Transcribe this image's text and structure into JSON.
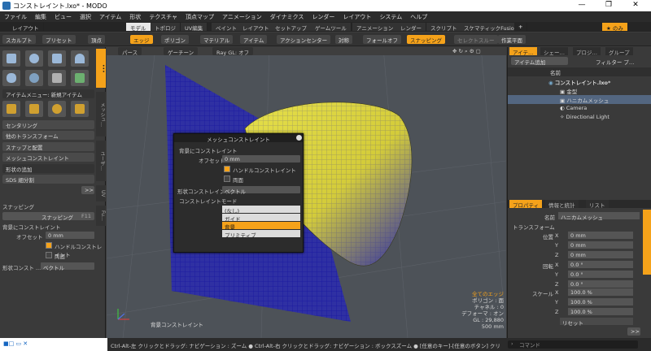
{
  "window": {
    "title": "コンストレイント.lxo* - MODO",
    "minimize": "—",
    "maximize": "❐",
    "close": "✕"
  },
  "menu": [
    "ファイル",
    "編集",
    "ビュー",
    "選択",
    "アイテム",
    "形状",
    "テクスチャ",
    "頂点マップ",
    "アニメーション",
    "ダイナミクス",
    "レンダー",
    "レイアウト",
    "システム",
    "ヘルプ"
  ],
  "layoutbar": {
    "layout_label": "レイアウト",
    "tabs": [
      "モデル",
      "トポロジ",
      "UV編集",
      "ペイント",
      "レイアウト",
      "セットアップ",
      "ゲームツール",
      "アニメーション",
      "レンダー",
      "スクリプト",
      "スケマティックFusion"
    ],
    "add": "+",
    "star": "★ のみ"
  },
  "toolbar": {
    "items": [
      "スカルプト",
      "プリセット",
      "頂点",
      "エッジ",
      "ポリゴン",
      "マテリアル",
      "アイテム",
      "アクションセンター",
      "対称",
      "フォールオフ",
      "スナッピング",
      "セレクトスルー",
      "作業平面"
    ]
  },
  "left": {
    "item_menu": "アイテムメニュー: 新規アイテム",
    "centering": "センタリング",
    "other_transform": "他のトランスフォーム",
    "snap_place": "スナップと配置",
    "mesh_constraint": "メッシュコンストレイント",
    "shape_add": "形状の追加",
    "sds": "SDS 細分割",
    "more": ">>",
    "snapping_header": "スナッピング",
    "snapping_btn": "スナッピング",
    "snapping_key": "F11",
    "bg_constraint": "背景にコンストレイント",
    "offset_label": "オフセット",
    "offset_value": "0 mm",
    "handle_constraint": "ハンドルコンストレイント",
    "both_sides": "両面",
    "shape_const_label": "形状コンスト ...",
    "shape_const_value": "ベクトル",
    "vtabs": [
      "メッシュ…",
      "ユーザ…",
      "UV",
      "Fu…"
    ]
  },
  "viewport": {
    "header": [
      "パース",
      "ゲーチーン",
      "Ray GL: オフ"
    ],
    "bottom_label": "背景コンストレイント",
    "stats": [
      "全てのエッジ",
      "ポリゴン : 面",
      "チャネル : 0",
      "デフォーマ : オン",
      "GL : 29,880",
      "500 mm"
    ]
  },
  "dialog": {
    "title": "メッシュコンストレイント",
    "section": "背景にコンストレイント",
    "offset_label": "オフセット",
    "offset_value": "0 mm",
    "handle": "ハンドルコンストレイント",
    "both": "両面",
    "shape_label": "形状コンストレイント",
    "shape_value": "ベクトル",
    "mode_section": "コンストレイントモード",
    "modes": [
      "(なし)",
      "ガイド",
      "背景",
      "プリミティブ"
    ]
  },
  "items_panel": {
    "tabs": [
      "アイテ…",
      "シェー…",
      "プロジ…",
      "グループ"
    ],
    "add_item": "アイテム追加",
    "filter": "フィルター プ…",
    "col_name": "名前",
    "rows": [
      "コンストレイント.lxo*",
      "金型",
      "ハニカムメッシュ",
      "Camera",
      "Directional Light"
    ]
  },
  "props_panel": {
    "tabs": [
      "プロパティ",
      "情報と統計",
      "リスト"
    ],
    "name_label": "名前",
    "name_value": "ハニカムメッシュ",
    "transform": "トランスフォーム",
    "pos_label": "位置",
    "rot_label": "回転",
    "scale_label": "スケール",
    "pos": [
      "0 mm",
      "0 mm",
      "0 mm"
    ],
    "rot": [
      "0.0 °",
      "0.0 °",
      "0.0 °"
    ],
    "scale": [
      "100.0 %",
      "100.0 %",
      "100.0 %"
    ],
    "reset": "リセット",
    "more": ">>",
    "axes": [
      "X",
      "Y",
      "Z"
    ]
  },
  "status": {
    "text": "Ctrl-Alt-左 クリックとドラッグ: ナビゲーション : ズーム ● Ctrl-Alt-右 クリックとドラッグ: ナビゲーション : ボックスズーム ● [任意のキー]-[任意のボタン] クリックとドラッグ: dragDr…",
    "command": "コマンド"
  }
}
